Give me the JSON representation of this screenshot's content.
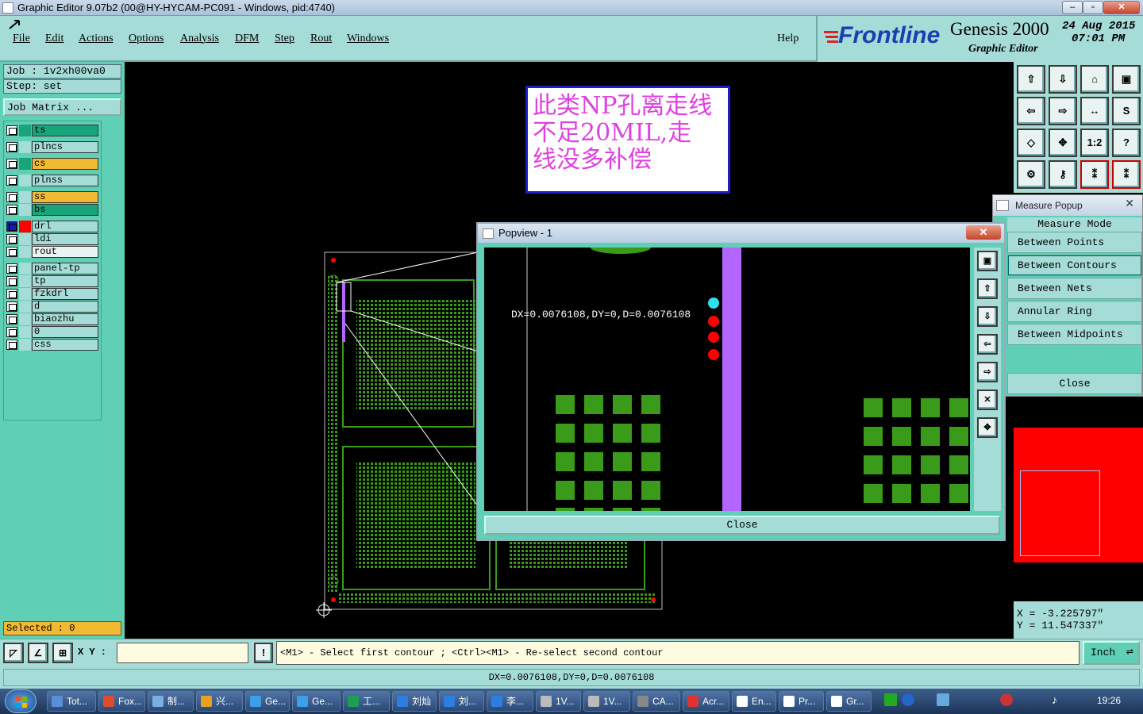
{
  "window": {
    "title": "Graphic Editor 9.07b2 (00@HY-HYCAM-PC091 - Windows, pid:4740)"
  },
  "menu": [
    "File",
    "Edit",
    "Actions",
    "Options",
    "Analysis",
    "DFM",
    "Step",
    "Rout",
    "Windows"
  ],
  "help_label": "Help",
  "brand": {
    "logo": "Frontline",
    "product": "Genesis 2000",
    "subtitle": "Graphic Editor",
    "date": "24 Aug 2015",
    "time": "07:01 PM"
  },
  "job": {
    "job_line": "Job : 1v2xh00va0",
    "step_line": "Step: set",
    "matrix_button": "Job Matrix ..."
  },
  "layers": [
    {
      "name": "ts",
      "color": "#1aa47a",
      "swatch": "#1aa47a"
    },
    {
      "name": "plncs",
      "color": "#a6dcd7",
      "swatch": "#a6dcd7"
    },
    {
      "name": "cs",
      "color": "#f2b933",
      "swatch": "#1aa47a"
    },
    {
      "name": "plnss",
      "color": "#a6dcd7",
      "swatch": "#a6dcd7"
    },
    {
      "name": "ss",
      "color": "#f2b933",
      "swatch": "#a6dcd7"
    },
    {
      "name": "bs",
      "color": "#1aa47a",
      "swatch": "#a6dcd7"
    },
    {
      "name": "drl",
      "color": "#a6dcd7",
      "swatch": "#ff0000",
      "active": true
    },
    {
      "name": "ldi",
      "color": "#a6dcd7",
      "swatch": "#a6dcd7"
    },
    {
      "name": "rout",
      "color": "#e8f3f2",
      "swatch": "#a6dcd7"
    },
    {
      "name": "panel-tp",
      "color": "#a6dcd7",
      "swatch": "#a6dcd7"
    },
    {
      "name": "tp",
      "color": "#a6dcd7",
      "swatch": "#a6dcd7"
    },
    {
      "name": "fzkdrl",
      "color": "#a6dcd7",
      "swatch": "#a6dcd7"
    },
    {
      "name": "d",
      "color": "#a6dcd7",
      "swatch": "#a6dcd7"
    },
    {
      "name": "biaozhu",
      "color": "#a6dcd7",
      "swatch": "#a6dcd7"
    },
    {
      "name": "0",
      "color": "#a6dcd7",
      "swatch": "#a6dcd7"
    },
    {
      "name": "css",
      "color": "#a6dcd7",
      "swatch": "#a6dcd7"
    }
  ],
  "selected_label": "Selected : 0",
  "annotation": {
    "line1": "此类NP孔离走线",
    "line2": "不足20MIL,走",
    "line3": "线没多补偿"
  },
  "tools": {
    "one_to_two": "1:2",
    "help": "?"
  },
  "measure_popup": {
    "title": "Measure Popup",
    "mode_label": "Measure Mode",
    "options": [
      "Between Points",
      "Between Contours",
      "Between Nets",
      "Annular Ring",
      "Between Midpoints"
    ],
    "close_label": "Close",
    "x_readout": "X = -3.225797\"",
    "y_readout": "Y = 11.547337\""
  },
  "popview": {
    "title": "Popview - 1",
    "measure_text": "DX=0.0076108,DY=0,D=0.0076108",
    "close_label": "Close"
  },
  "bottom": {
    "xy_label": "X Y :",
    "xy_value": "",
    "warn": "!",
    "prompt": "<M1> - Select first contour ; <Ctrl><M1> - Re-select second contour",
    "units": "Inch",
    "status": "DX=0.0076108,DY=0,D=0.0076108"
  },
  "taskbar": {
    "items": [
      "Tot...",
      "Fox...",
      "制...",
      "兴...",
      "Ge...",
      "Ge...",
      "工...",
      "刘灿",
      "刘...",
      "李...",
      "1V...",
      "1V...",
      "CA...",
      "Acr...",
      "En...",
      "Pr...",
      "Gr..."
    ],
    "clock": "19:26"
  },
  "colors": {
    "panel": "#a6dcd7",
    "teal": "#5fcfb5",
    "trace": "#3a9a1a",
    "drill": "#ff0000",
    "rout": "#b266ff",
    "annotation": "#e040e0"
  }
}
